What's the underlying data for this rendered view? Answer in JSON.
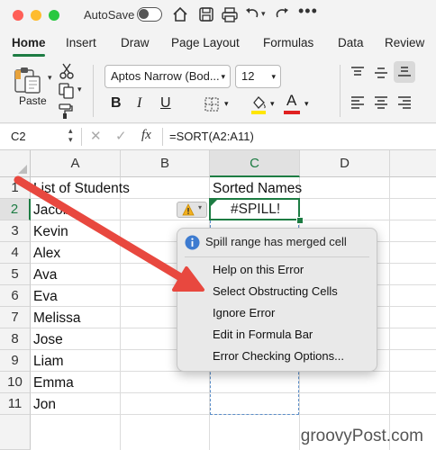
{
  "titlebar": {
    "autosave_label": "AutoSave",
    "traffic_lights": [
      "#ff5f57",
      "#febc2e",
      "#28c840"
    ],
    "icons": [
      "home-icon",
      "save-icon",
      "print-icon",
      "undo-icon",
      "redo-icon",
      "more-icon"
    ]
  },
  "tabs": [
    "Home",
    "Insert",
    "Draw",
    "Page Layout",
    "Formulas",
    "Data",
    "Review"
  ],
  "ribbon": {
    "paste_label": "Paste",
    "font_name": "Aptos Narrow (Bod...",
    "font_size": "12",
    "icons": [
      "paste-icon",
      "cut-icon",
      "copy-icon",
      "format-painter-icon",
      "bold-icon",
      "italic-icon",
      "underline-icon",
      "borders-icon",
      "fill-color-icon",
      "font-color-icon",
      "align-icons"
    ],
    "highlight_color": "#ffe600",
    "font_color": "#e02020"
  },
  "formula_bar": {
    "cell_ref": "C2",
    "fx_label": "fx",
    "formula": "=SORT(A2:A11)"
  },
  "sheet": {
    "columns": [
      "A",
      "B",
      "C",
      "D"
    ],
    "rows": [
      "1",
      "2",
      "3",
      "4",
      "5",
      "6",
      "7",
      "8",
      "9",
      "10",
      "11"
    ],
    "col_a": [
      "List of Students",
      "Jacob",
      "Kevin",
      "Alex",
      "Ava",
      "Eva",
      "Melissa",
      "Jose",
      "Liam",
      "Emma",
      "Jon"
    ],
    "c1": "Sorted Names",
    "c2": "#SPILL!",
    "warning_icon": "warning-icon",
    "accent": "#1d7c43"
  },
  "menu": {
    "header": "Spill range has merged cell",
    "items": [
      "Help on this Error",
      "Select Obstructing Cells",
      "Ignore Error",
      "Edit in Formula Bar",
      "Error Checking Options..."
    ]
  },
  "annotation": {
    "arrow_color": "#e8483f"
  },
  "footer": {
    "brand": "groovyPost.com"
  }
}
